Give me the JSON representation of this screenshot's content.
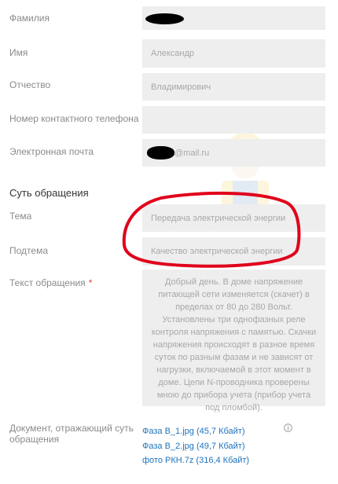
{
  "form": {
    "surname": {
      "label": "Фамилия",
      "value": ""
    },
    "name": {
      "label": "Имя",
      "value": "Александр"
    },
    "patronymic": {
      "label": "Отчество",
      "value": "Владимирович"
    },
    "phone": {
      "label": "Номер контактного телефона",
      "value": ""
    },
    "email": {
      "label": "Электронная почта",
      "value_suffix": "@mail.ru"
    },
    "section_title": "Суть обращения",
    "topic": {
      "label": "Тема",
      "value": "Передача электрической энергии"
    },
    "subtopic": {
      "label": "Подтема",
      "value": "Качество электрической энергии"
    },
    "message": {
      "label": "Текст обращения",
      "required_mark": "*",
      "value": "Добрый день. В доме напряжение питающей сети изменяется (скачет) в пределах от 80 до 280 Вольт. Установлены три однофазных реле контроля напряжения с памятью. Скачки напряжения происходят в разное время суток по разным фазам и не зависят от нагрузки, включаемой в этот момент в доме. Цепи N-проводника проверены мною до прибора учета (прибор учета под пломбой)."
    },
    "attachments": {
      "label_line1": "Документ, отражающий суть",
      "label_line2": "обращения",
      "files": [
        "Фаза В_1.jpg (45,7 Кбайт)",
        "Фаза В_2.jpg (49,7 Кбайт)",
        "фото РКН.7z (316,4 Кбайт)"
      ]
    }
  },
  "colors": {
    "field_bg": "#eeeeee",
    "label": "#8a8a8a",
    "link": "#1e73be",
    "required": "#e53935",
    "annotation": "#e0001b"
  },
  "icons": [
    "info-icon",
    "worker-watermark-icon"
  ]
}
